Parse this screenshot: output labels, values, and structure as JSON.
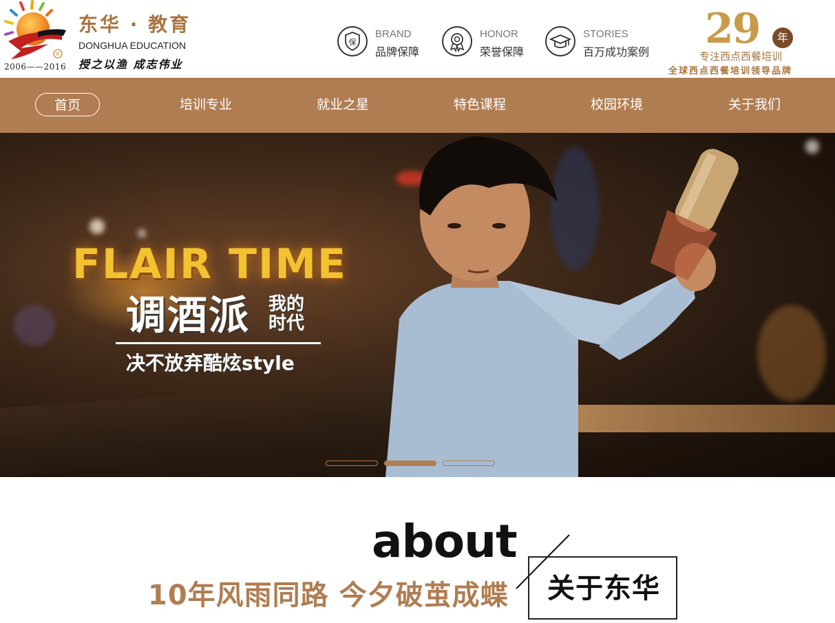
{
  "header": {
    "logo": {
      "years": "2006——2016",
      "name_cn": "东华 · 教育",
      "name_en": "DONGHUA EDUCATION",
      "motto": "授之以渔 成志伟业"
    },
    "badges": [
      {
        "icon": "shield-icon",
        "glyph": "保",
        "en": "BRAND",
        "cn": "品牌保障"
      },
      {
        "icon": "medal-icon",
        "glyph": "",
        "en": "HONOR",
        "cn": "荣誉保障"
      },
      {
        "icon": "graduation-cap-icon",
        "glyph": "",
        "en": "STORIES",
        "cn": "百万成功案例"
      }
    ],
    "anniversary": {
      "number": "29",
      "unit": "年",
      "subtitle": "专注西点西餐培训",
      "slogan": "全球西点西餐培训领导品牌"
    }
  },
  "nav": {
    "items": [
      {
        "label": "首页",
        "active": true
      },
      {
        "label": "培训专业",
        "active": false
      },
      {
        "label": "就业之星",
        "active": false
      },
      {
        "label": "特色课程",
        "active": false
      },
      {
        "label": "校园环境",
        "active": false
      },
      {
        "label": "关于我们",
        "active": false
      }
    ]
  },
  "banner": {
    "headline": "FLAIR TIME",
    "title_cn": "调酒派",
    "side_line1": "我的",
    "side_line2": "时代",
    "tagline": "决不放弃酷炫style",
    "slides": 3,
    "active_slide": 2
  },
  "about": {
    "title_en": "about",
    "slogan": "10年风雨同路 今夕破茧成蝶",
    "label": "关于东华"
  },
  "colors": {
    "brand": "#b07d52",
    "brand_text": "#a9743f",
    "gold": "#c99a4a",
    "flair_yellow": "#f2c230"
  }
}
